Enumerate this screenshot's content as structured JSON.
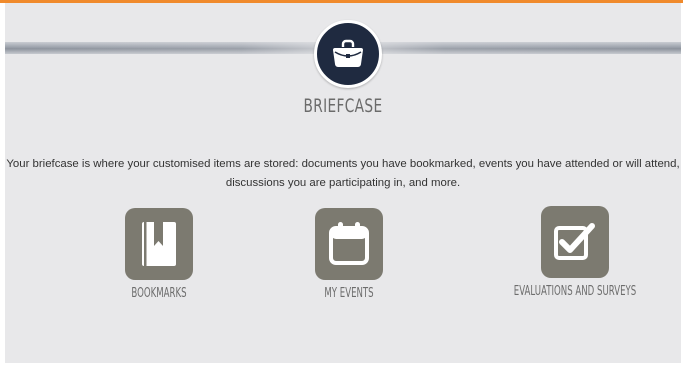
{
  "page": {
    "title": "BRIEFCASE",
    "intro_line1": "Your briefcase is where your customised items are stored: documents you have bookmarked, events you have attended or will attend,",
    "intro_line2": "discussions you are participating in, and more."
  },
  "tiles": [
    {
      "label": "BOOKMARKS",
      "icon": "bookmark-icon"
    },
    {
      "label": "MY EVENTS",
      "icon": "calendar-icon"
    },
    {
      "label": "EVALUATIONS AND SURVEYS",
      "icon": "checkbox-icon"
    }
  ],
  "colors": {
    "accent": "#f08a2c",
    "hero_circle": "#1f2a40",
    "tile_bg": "#7c7a70",
    "panel_bg": "#e8e8ea"
  },
  "hero_icon": "briefcase-icon"
}
